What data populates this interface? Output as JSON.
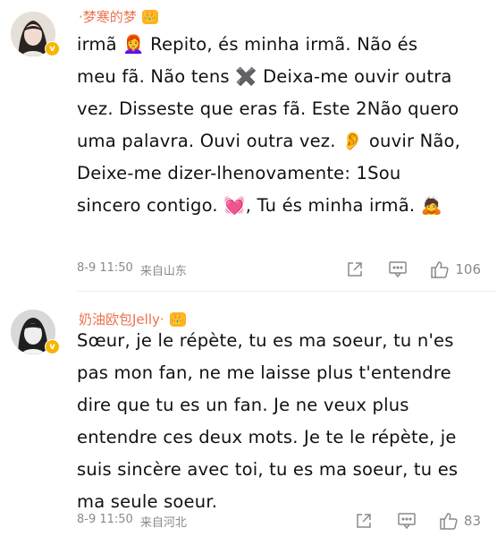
{
  "comments": [
    {
      "username": "·梦寒的梦",
      "badge": "👑",
      "text": "irmã 👩‍🦰 Repito, és minha irmã.  Não és meu fã. Não tens ✖️ Deixa-me ouvir outra vez.  Disseste que eras fã. Este 2Não quero uma palavra.  Ouvi outra vez. 👂 ouvir Não, Deixe-me dizer-lhenovamente: 1Sou sincero contigo. 💓,  Tu és minha irmã. 🙇",
      "time": "8-9 11:50",
      "location": "来自山东",
      "likes": "106"
    },
    {
      "username": "奶油欧包Jelly·",
      "badge": "👑",
      "text": "Sœur, je le répète, tu es ma soeur, tu n'es pas mon fan, ne me laisse plus t'entendre dire que tu es un fan. Je ne veux plus entendre ces deux mots. Je te le répète, je suis sincère avec toi, tu es ma soeur, tu es ma seule soeur.",
      "time": "8-9 11:50",
      "location": "来自河北",
      "likes": "83"
    }
  ],
  "icons": {
    "share": "share-icon",
    "comment": "comment-icon",
    "like": "thumbs-up-icon",
    "verified": "verified-badge-icon"
  },
  "colors": {
    "username": "#eb7350",
    "meta": "#8a8a8a",
    "badge": "#ffb21e",
    "verified": "#f7b500"
  }
}
